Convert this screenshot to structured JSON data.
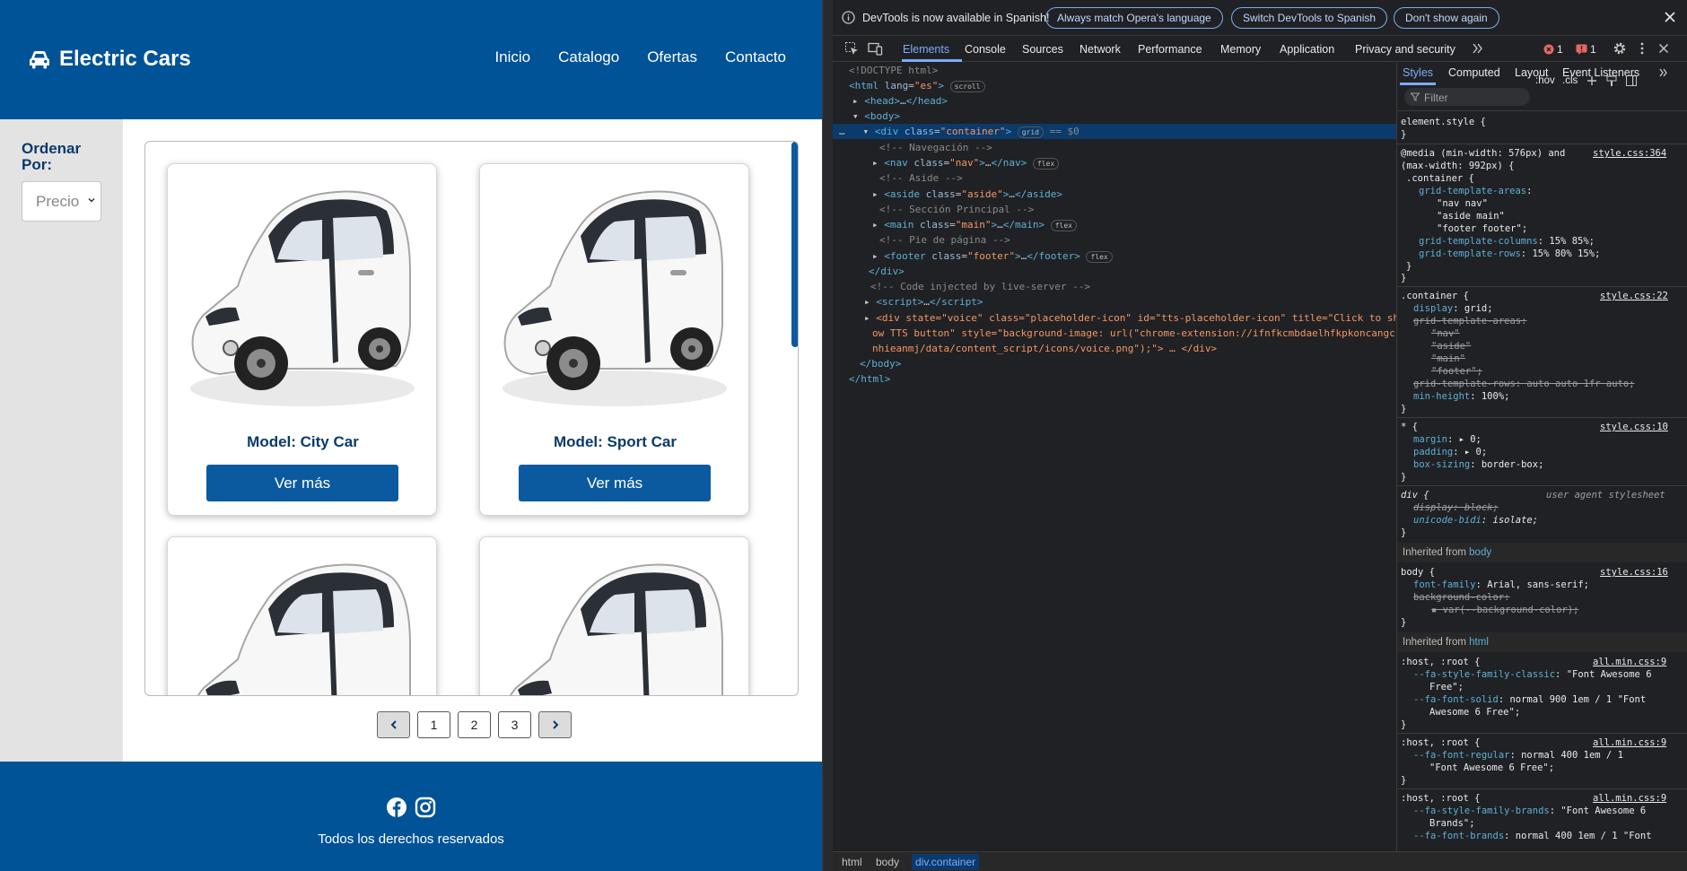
{
  "site": {
    "brand": "Electric Cars",
    "menu": [
      "Inicio",
      "Catalogo",
      "Ofertas",
      "Contacto"
    ],
    "sort_label": "Ordenar Por:",
    "sort_value": "Precio",
    "cards": [
      {
        "title": "Model: City Car",
        "button": "Ver más"
      },
      {
        "title": "Model: Sport Car",
        "button": "Ver más"
      },
      {
        "title": "",
        "button": ""
      },
      {
        "title": "",
        "button": ""
      }
    ],
    "pages": [
      "1",
      "2",
      "3"
    ],
    "footer_text": "Todos los derechos reservados"
  },
  "devtools": {
    "info_text": "DevTools is now available in Spanish!",
    "info_buttons": [
      "Always match Opera's language",
      "Switch DevTools to Spanish",
      "Don't show again"
    ],
    "tabs": [
      "Elements",
      "Console",
      "Sources",
      "Network",
      "Performance",
      "Memory",
      "Application",
      "Privacy and security"
    ],
    "active_tab": "Elements",
    "errors": "1",
    "issues": "1",
    "styles_tabs": [
      "Styles",
      "Computed",
      "Layout",
      "Event Listeners"
    ],
    "filter_placeholder": "Filter",
    "hov": ":hov",
    "cls": ".cls",
    "breadcrumbs": [
      "html",
      "body",
      "div.container"
    ],
    "dom_text": {
      "doctype": "<!DOCTYPE html>",
      "scroll": "scroll",
      "grid": "grid",
      "flex": "flex",
      "eq": "== $0",
      "c_nav": "<!-- Navegación -->",
      "c_aside": "<!-- Aside -->",
      "c_main": "<!-- Sección Principal -->",
      "c_footer": "<!-- Pie de página -->",
      "c_live": "<!-- Code injected by live-server -->",
      "voice_1": "<div state=\"voice\" class=\"placeholder-icon\" id=\"tts-placeholder-icon\" title=\"Click to sh",
      "voice_2": "ow TTS button\" style=\"background-image: url(\"chrome-extension://ifnfkcmbdaelhfkpkoncangc",
      "voice_3": "nhieanmj/data/content_script/icons/voice.png\");\"> … </div>"
    },
    "styles_text": {
      "element_style": "element.style {",
      "media_1": "@media (min-width: 576px) and",
      "media_2": "(max-width: 992px) {",
      "style_364": "style.css:364",
      "style_22": "style.css:22",
      "style_10": "style.css:10",
      "style_16": "style.css:16",
      "all_min": "all.min.css:9",
      "ua": "user agent stylesheet",
      "inherited_body": "Inherited from",
      "body_tag": "body",
      "html_tag": "html"
    }
  }
}
